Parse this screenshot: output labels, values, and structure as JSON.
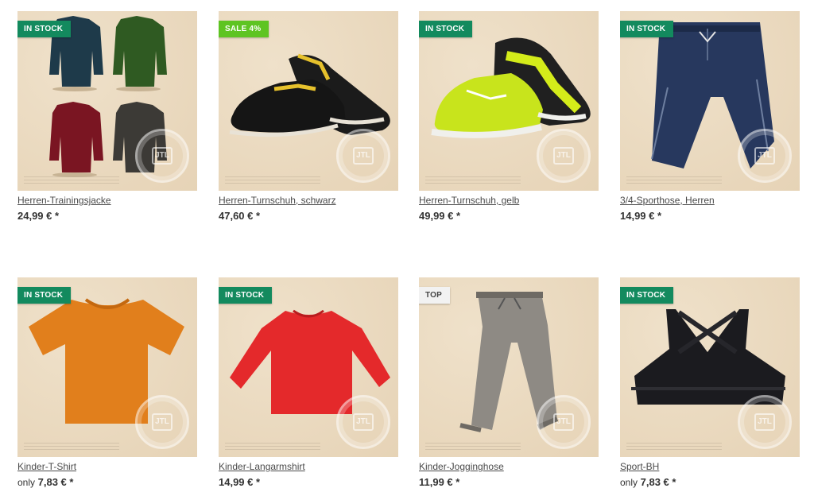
{
  "products": [
    {
      "name": "Herren-Trainingsjacke",
      "badge": "IN STOCK",
      "price_prefix": "",
      "price": "24,99 € *"
    },
    {
      "name": "Herren-Turnschuh, schwarz",
      "badge": "SALE 4%",
      "price_prefix": "",
      "price": "47,60 € *"
    },
    {
      "name": "Herren-Turnschuh, gelb",
      "badge": "IN STOCK",
      "price_prefix": "",
      "price": "49,99 € *"
    },
    {
      "name": "3/4-Sporthose, Herren",
      "badge": "IN STOCK",
      "price_prefix": "",
      "price": "14,99 € *"
    },
    {
      "name": "Kinder-T-Shirt",
      "badge": "IN STOCK",
      "price_prefix": "only",
      "price": "7,83 € *"
    },
    {
      "name": "Kinder-Langarmshirt",
      "badge": "IN STOCK",
      "price_prefix": "",
      "price": "14,99 € *"
    },
    {
      "name": "Kinder-Jogginghose",
      "badge": "TOP",
      "price_prefix": "",
      "price": "11,99 € *"
    },
    {
      "name": "Sport-BH",
      "badge": "IN STOCK",
      "price_prefix": "only",
      "price": "7,83 € *"
    }
  ],
  "seal_text": "JTL",
  "colors": {
    "in_stock": "#138a5e",
    "sale": "#5ec422",
    "top": "#f2f2f2",
    "tile_bg": "#ead9bf"
  }
}
